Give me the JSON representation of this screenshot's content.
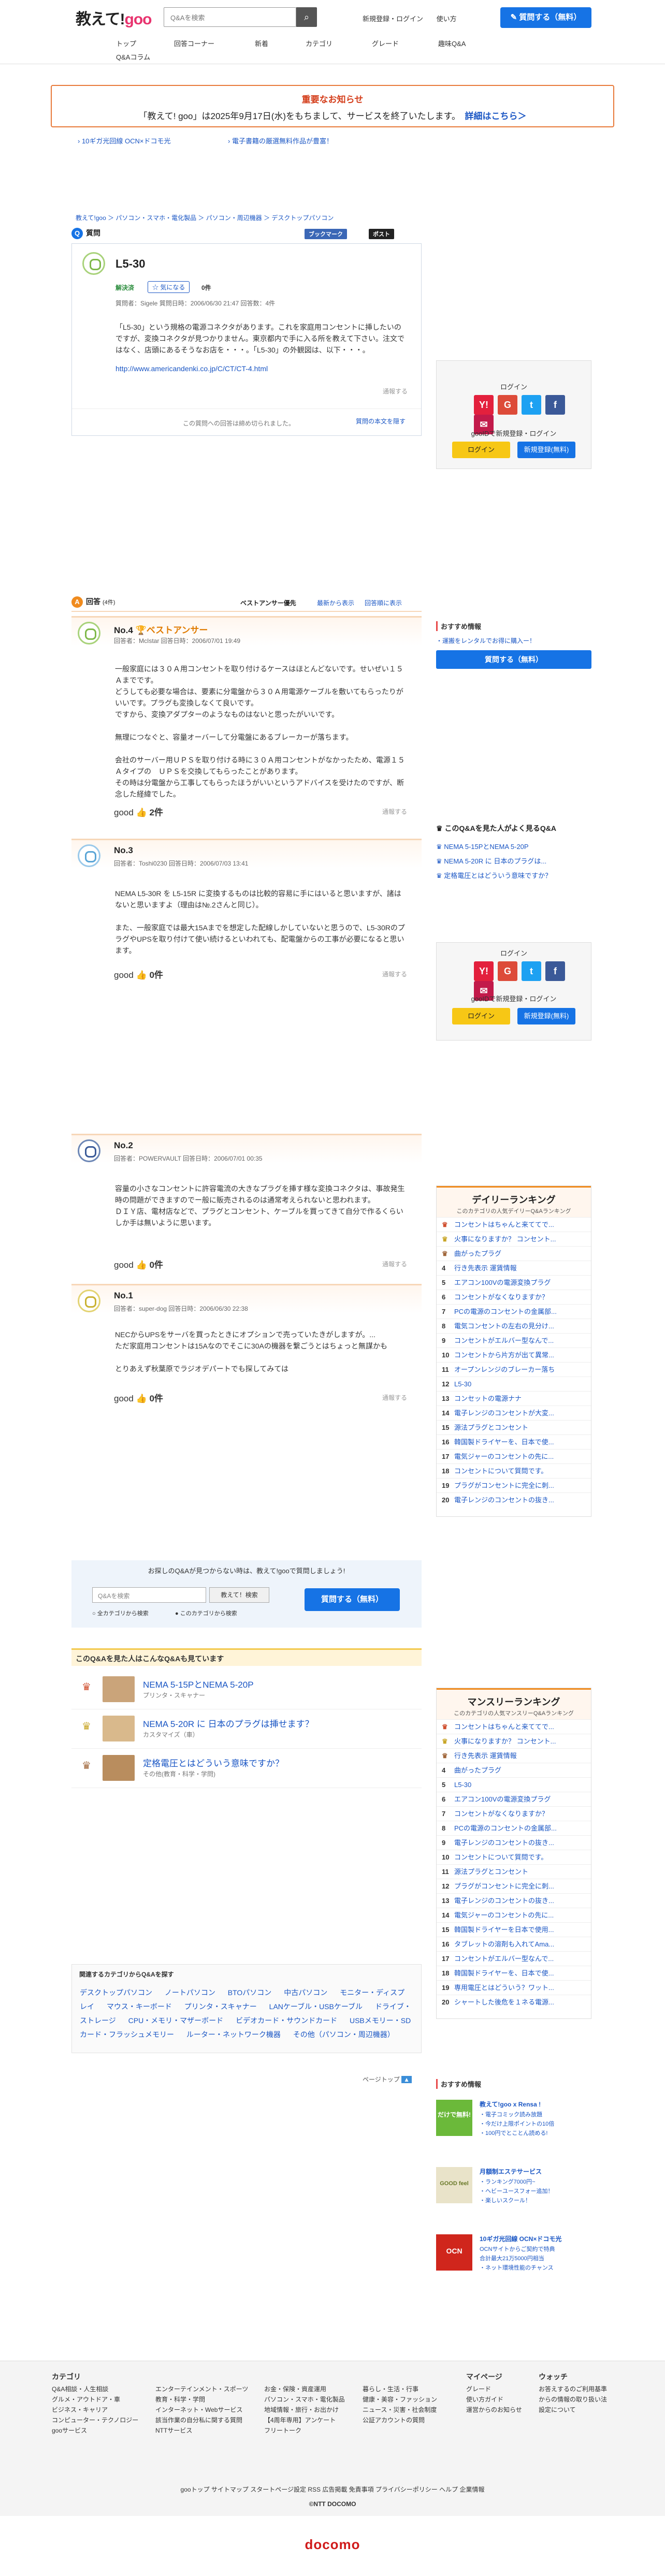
{
  "header": {
    "logo_pre": "教えて!",
    "logo_goo": "goo",
    "search_placeholder": "Q&Aを検索",
    "login": "新規登録・ログイン",
    "help": "使い方",
    "ask": "質問する（無料）"
  },
  "nav": [
    "トップ",
    "回答コーナー",
    "新着",
    "カテゴリ",
    "グレード",
    "趣味Q&A",
    "Q&Aコラム"
  ],
  "notice": {
    "title": "重要なお知らせ",
    "body": "「教えて! goo」は2025年9月17日(水)をもちまして、サービスを終了いたします。",
    "link": "詳細はこちら＞"
  },
  "ads": [
    "10ギガ光回線 OCN×ドコモ光",
    "電子書籍の厳選無料作品が豊富！"
  ],
  "breadcrumb": "教えて!goo ＞ パソコン・スマホ・電化製品 ＞ パソコン・周辺機器 ＞ デスクトップパソコン",
  "question": {
    "section": "質問",
    "share": "ブックマーク",
    "tweet": "ポスト",
    "title": "L5-30",
    "status": "解決済",
    "helpful": "気になる",
    "helpful_count": "0件",
    "meta": "質問者：Sigele  質問日時：2006/06/30 21:47  回答数：4件",
    "body": "「L5-30」という規格の電源コネクタがあります。これを家庭用コンセントに挿したいのですが、変換コネクタが見つかりません。東京都内で手に入る所を教えて下さい。注文ではなく、店頭にあるそうなお店を・・・。「L5-30」の外観図は、以下・・・。",
    "url": "http://www.americandenki.co.jp/C/CT/CT-4.html",
    "report": "通報する",
    "closed": "この質問への回答は締め切られました。",
    "fulltext": "質問の本文を隠す"
  },
  "answers_header": {
    "section": "回答",
    "count": "(4件)",
    "tabs": [
      "ベストアンサー優先",
      "最新から表示",
      "回答順に表示"
    ]
  },
  "answers": [
    {
      "no": "No.4",
      "best": "ベストアンサー",
      "meta": "回答者：McIstar  回答日時：2006/07/01 19:49",
      "body": "一般家庭には３０Ａ用コンセントを取り付けるケースはほとんどないです。せいぜい１５Ａまでです。\nどうしても必要な場合は、要素に分電盤から３０Ａ用電源ケーブルを敷いてもらったりがいいです。プラグも変換しなくて良いです。\nですから、変換アダプターのようなものはないと思ったがいいです。\n\n無理につなぐと、容量オーバーして分電盤にあるブレーカーが落ちます。\n\n会社のサーバー用ＵＰＳを取り付ける時に３０Ａ用コンセントがなかったため、電源１５Ａタイプの　ＵＰＳを交換してもらったことがあります。\nその時は分電盤から工事してもらったほうがいいというアドバイスを受けたのですが、断念した経緯でした。",
      "good": "good",
      "good_count": "2件",
      "report": "通報する"
    },
    {
      "no": "No.3",
      "meta": "回答者：Toshi0230  回答日時：2006/07/03 13:41",
      "body": "NEMA L5-30R を L5-15R に変換するものは比較的容易に手にはいると思いますが、諸はないと思いますよ（理由は№.2さんと同じ）。\n\nまた、一般家庭では最大15Aまでを想定した配線しかしていないと思うので、L5-30RのプラグやUPSを取り付けて使い続けるといわれても、配電盤からの工事が必要になると思います。",
      "good": "good",
      "good_count": "0件",
      "report": "通報する"
    },
    {
      "no": "No.2",
      "meta": "回答者：POWERVAULT  回答日時：2006/07/01 00:35",
      "body": "容量の小さなコンセントに許容電流の大きなプラグを挿す様な変換コネクタは、事故発生時の問題ができますのでー般に販売されるのは通常考えられないと思われます。\nＤＩＹ店、電材店などで、プラグとコンセント、ケーブルを買ってきて自分で作るくらいしか手は無いように思います。",
      "good": "good",
      "good_count": "0件",
      "report": "通報する"
    },
    {
      "no": "No.1",
      "meta": "回答者：super-dog  回答日時：2006/06/30 22:38",
      "body": "NECからUPSをサーバを買ったときにオプションで売っていたきがしますが。...\nただ家庭用コンセントは15Aなのでそこに30Aの機器を繋ごうとはちょっと無謀かも\n\nとりあえず秋葉原でラジオデパートでも探してみては",
      "good": "good",
      "good_count": "0件",
      "report": "通報する"
    }
  ],
  "ask_box": {
    "text": "お探しのQ&Aが見つからない時は、教えて!gooで質問しましょう!",
    "placeholder": "Q&Aを検索",
    "search": "教えて！検索",
    "opt1": "全カテゴリから検索",
    "opt2": "このカテゴリから検索",
    "ask": "質問する（無料）"
  },
  "related": {
    "title": "このQ&Aを見た人はこんなQ&Aも見ています",
    "items": [
      {
        "title": "NEMA 5-15PとNEMA 5-20P",
        "cat": "プリンタ・スキャナー"
      },
      {
        "title": "NEMA 5-20R に 日本のプラグは挿せます？",
        "cat": "カスタマイズ（車）"
      },
      {
        "title": "定格電圧とはどういう意味ですか？",
        "cat": "その他(教育・科学・学問)"
      }
    ]
  },
  "categories": {
    "title": "関連するカテゴリからQ&Aを探す",
    "items": [
      "デスクトップパソコン",
      "ノートパソコン",
      "BTOパソコン",
      "中古パソコン",
      "モニター・ディスプレイ",
      "マウス・キーボード",
      "プリンタ・スキャナー",
      "LANケーブル・USBケーブル",
      "ドライブ・ストレージ",
      "CPU・メモリ・マザーボード",
      "ビデオカード・サウンドカード",
      "USBメモリー・SDカード・フラッシュメモリー",
      "ルーター・ネットワーク機器",
      "その他（パソコン・周辺機器）"
    ],
    "pagetop": "ページトップ"
  },
  "login_box": {
    "title": "ログイン",
    "text": "gooIDで新規登録・ログイン",
    "login": "ログイン",
    "register": "新規登録(無料)"
  },
  "side_reco": {
    "title": "おすすめ情報",
    "link": "・運搬をレンタルでお得に購入ー！",
    "ask": "質問する（無料）"
  },
  "seen": {
    "title": "このQ&Aを見た人がよく見るQ&A",
    "items": [
      "NEMA 5-15PとNEMA 5-20P",
      "NEMA 5-20R に 日本のプラグは...",
      "定格電圧とはどういう意味ですか？"
    ]
  },
  "daily": {
    "title": "デイリーランキング",
    "sub": "このカテゴリの人気デイリーQ&Aランキング",
    "items": [
      "コンセントはちゃんと来ててで...",
      "火事になりますか？ コンセント...",
      "曲がったプラグ",
      "行き先表示 運賃情報",
      "エアコン100Vの電源変換プラグ",
      "コンセントがなくなりますか？",
      "PCの電源のコンセントの金属部...",
      "電気コンセントの左右の見分け...",
      "コンセントがエルバー型なんで...",
      "コンセントから片方が出て異常...",
      "オープンレンジのブレーカー落ち",
      "L5-30",
      "コンセットの電源ナナ",
      "電子レンジのコンセントが大変...",
      "源法プラグとコンセント",
      "韓国製ドライヤーを、日本で使...",
      "電気ジャーのコンセントの先に...",
      "コンセントについて質問です。",
      "プラグがコンセントに完全に刺...",
      "電子レンジのコンセントの抜き..."
    ]
  },
  "monthly": {
    "title": "マンスリーランキング",
    "sub": "このカテゴリの人気マンスリーQ&Aランキング",
    "items": [
      "コンセントはちゃんと来ててで...",
      "火事になりますか？ コンセント...",
      "行き先表示 運賃情報",
      "曲がったプラグ",
      "L5-30",
      "エアコン100Vの電源変換プラグ",
      "コンセントがなくなりますか？",
      "PCの電源のコンセントの金属部...",
      "電子レンジのコンセントの抜き...",
      "コンセントについて質問です。",
      "源法プラグとコンセント",
      "プラグがコンセントに完全に刺...",
      "電子レンジのコンセントの抜き...",
      "電気ジャーのコンセントの先に...",
      "韓国製ドライヤーを日本で使用...",
      "タブレットの溶剤も入れてAma...",
      "コンセントがエルバー型なんで...",
      "韓国製ドライヤーを、日本で使...",
      "専用電圧とはどういう？ワット...",
      "シャートした後危を１ネる電源..."
    ]
  },
  "side_reco2": {
    "title": "おすすめ情報",
    "items": [
      {
        "name": "教えて!goo x Rensa !",
        "lines": [
          "・電子コミック読み放題",
          "・今だけ上限ポイントの10倍",
          "・100円でとことん読める!"
        ],
        "badge": "だけで無料!"
      },
      {
        "name": "月額制エステサービス",
        "lines": [
          "・ランキング7000円~",
          "・ヘビーユースフォー追加！",
          "・楽しいスクール！"
        ],
        "badge": "GOOD feel"
      },
      {
        "name": "10ギガ光回線 OCN×ドコモ光",
        "lines": [
          "OCNサイトからご契約で特典",
          "合計最大21万5000円相当",
          "・ネット環境性能のチャンス"
        ],
        "badge": "OCN"
      }
    ]
  },
  "footer": {
    "cols": [
      {
        "title": "カテゴリ",
        "items": [
          "Q&A相談・人生相談",
          "グルメ・アウトドア・車",
          "ビジネス・キャリア",
          "コンピューター・テクノロジー",
          "gooサービス"
        ]
      },
      {
        "title": "",
        "items": [
          "エンターテインメント・スポーツ",
          "教育・科学・学問",
          "インターネット・Webサービス",
          "該当作業の自分私に関する質問",
          "NTTサービス"
        ]
      },
      {
        "title": "",
        "items": [
          "お金・保険・資産運用",
          "パソコン・スマホ・電化製品",
          "地域情報・旅行・お出かけ",
          "【4周年専用】アンケート",
          "フリートーク"
        ]
      },
      {
        "title": "",
        "items": [
          "暮らし・生活・行事",
          "健康・美容・ファッション",
          "ニュース・災害・社会制度",
          "公証アカウントの質問"
        ]
      },
      {
        "title": "マイページ",
        "items": [
          "グレード",
          "使い方ガイド",
          "運営からのお知らせ"
        ]
      },
      {
        "title": "ウォッチ",
        "items": [
          "お答えするのご利用基準からの情報の取り扱い法設定について"
        ]
      }
    ],
    "links": "gooトップ  サイトマップ  スタートページ設定  RSS  広告掲載  免責事項  プライバシーポリシー  ヘルプ  企業情報",
    "copy": "©NTT DOCOMO",
    "docomo": "docomo"
  }
}
